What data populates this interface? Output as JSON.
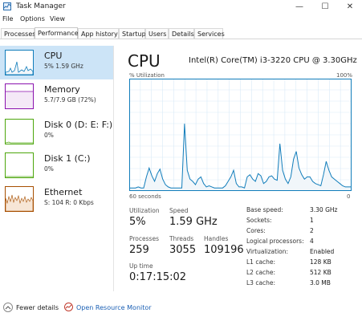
{
  "window": {
    "title": "Task Manager",
    "min": "—",
    "max": "☐",
    "close": "✕"
  },
  "menu": [
    "File",
    "Options",
    "View"
  ],
  "tabs": [
    "Processes",
    "Performance",
    "App history",
    "Startup",
    "Users",
    "Details",
    "Services"
  ],
  "active_tab": "Performance",
  "sidebar": {
    "items": [
      {
        "name": "CPU",
        "sub": "5%  1.59 GHz",
        "color": "#117dbb"
      },
      {
        "name": "Memory",
        "sub": "5.7/7.9 GB (72%)",
        "color": "#8b12ae"
      },
      {
        "name": "Disk 0 (D: E: F:)",
        "sub": "0%",
        "color": "#4da60c"
      },
      {
        "name": "Disk 1 (C:)",
        "sub": "0%",
        "color": "#4da60c"
      },
      {
        "name": "Ethernet",
        "sub": "S: 104  R: 0 Kbps",
        "color": "#a74f01"
      }
    ]
  },
  "main": {
    "title": "CPU",
    "model": "Intel(R) Core(TM) i3-3220 CPU @ 3.30GHz",
    "graph_label": "% Utilization",
    "graph_max": "100%",
    "axis_left": "60 seconds",
    "axis_right": "0",
    "utilization_series": [
      2,
      2,
      2,
      3,
      2,
      2,
      12,
      20,
      13,
      8,
      15,
      19,
      10,
      5,
      3,
      2,
      2,
      2,
      2,
      2,
      60,
      18,
      10,
      8,
      5,
      10,
      12,
      6,
      3,
      4,
      3,
      2,
      2,
      2,
      2,
      4,
      8,
      12,
      18,
      6,
      3,
      3,
      2,
      12,
      14,
      10,
      8,
      15,
      13,
      6,
      8,
      12,
      13,
      10,
      9,
      42,
      18,
      10,
      6,
      12,
      28,
      35,
      20,
      14,
      10,
      12,
      12,
      8,
      6,
      5,
      4,
      14,
      26,
      18,
      12,
      10,
      8,
      6,
      4,
      3,
      3,
      3
    ],
    "stats": {
      "utilization_label": "Utilization",
      "utilization": "5%",
      "speed_label": "Speed",
      "speed": "1.59 GHz",
      "processes_label": "Processes",
      "processes": "259",
      "threads_label": "Threads",
      "threads": "3055",
      "handles_label": "Handles",
      "handles": "109196",
      "uptime_label": "Up time",
      "uptime": "0:17:15:02"
    },
    "details": [
      {
        "label": "Base speed:",
        "value": "3.30 GHz"
      },
      {
        "label": "Sockets:",
        "value": "1"
      },
      {
        "label": "Cores:",
        "value": "2"
      },
      {
        "label": "Logical processors:",
        "value": "4"
      },
      {
        "label": "Virtualization:",
        "value": "Enabled"
      },
      {
        "label": "L1 cache:",
        "value": "128 KB"
      },
      {
        "label": "L2 cache:",
        "value": "512 KB"
      },
      {
        "label": "L3 cache:",
        "value": "3.0 MB"
      }
    ]
  },
  "footer": {
    "fewer_details": "Fewer details",
    "open_resource_monitor": "Open Resource Monitor"
  }
}
